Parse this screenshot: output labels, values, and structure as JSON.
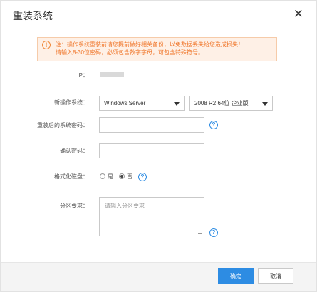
{
  "dialog": {
    "title": "重装系统",
    "close_glyph": "✕"
  },
  "warning": {
    "icon": "!",
    "line1": "注：操作系统重装前请您提前做好相关备份，以免数据丢失给您造成损失！",
    "line2": "请输入8-30位密码，必须包含数字字母，可包含特殊符号。"
  },
  "form": {
    "ip_label": "IP：",
    "os_label": "新操作系统：",
    "os_family": "Windows Server",
    "os_version": "2008 R2 64位 企业版",
    "password_label": "重装后的系统密码：",
    "password_value": "",
    "confirm_label": "确认密码：",
    "confirm_value": "",
    "format_label": "格式化磁盘：",
    "format_yes": "是",
    "format_no": "否",
    "format_selected": "否",
    "partition_label": "分区要求：",
    "partition_placeholder": "请输入分区要求",
    "help_glyph": "?"
  },
  "footer": {
    "ok_label": "确定",
    "cancel_label": "取消"
  },
  "colors": {
    "accent": "#2d8ce3",
    "warning_text": "#f0762a",
    "warning_bg": "#fef0e6"
  }
}
